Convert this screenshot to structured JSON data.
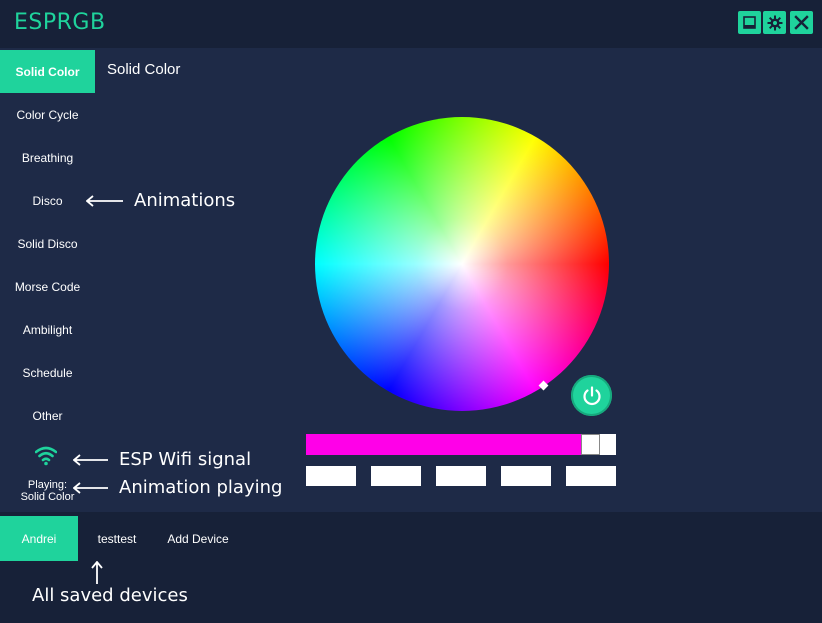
{
  "app": {
    "title": "ESPRGB"
  },
  "window_controls": [
    {
      "name": "minimize-icon"
    },
    {
      "name": "gear-icon"
    },
    {
      "name": "close-icon"
    }
  ],
  "sidebar": {
    "items": [
      {
        "label": "Solid Color",
        "active": true
      },
      {
        "label": "Color Cycle"
      },
      {
        "label": "Breathing"
      },
      {
        "label": "Disco"
      },
      {
        "label": "Solid Disco"
      },
      {
        "label": "Morse Code"
      },
      {
        "label": "Ambilight"
      },
      {
        "label": "Schedule"
      },
      {
        "label": "Other"
      }
    ],
    "status": {
      "playing_line1": "Playing:",
      "playing_line2": "Solid Color"
    }
  },
  "main": {
    "header": "Solid Color",
    "brightness_color": "#ff00e8",
    "brightness_value": 0.945,
    "presets": [
      "#ffffff",
      "#ffffff",
      "#ffffff",
      "#ffffff",
      "#ffffff"
    ]
  },
  "annotations": {
    "animations": "Animations",
    "wifi": "ESP Wifi signal",
    "playing": "Animation playing",
    "devices": "All saved devices"
  },
  "devices": {
    "tabs": [
      {
        "label": "Andrei",
        "active": true
      },
      {
        "label": "testtest"
      },
      {
        "label": "Add Device"
      }
    ]
  },
  "colors": {
    "accent": "#1fd39c",
    "background": "#1e2a47",
    "titlebar": "#172138"
  }
}
